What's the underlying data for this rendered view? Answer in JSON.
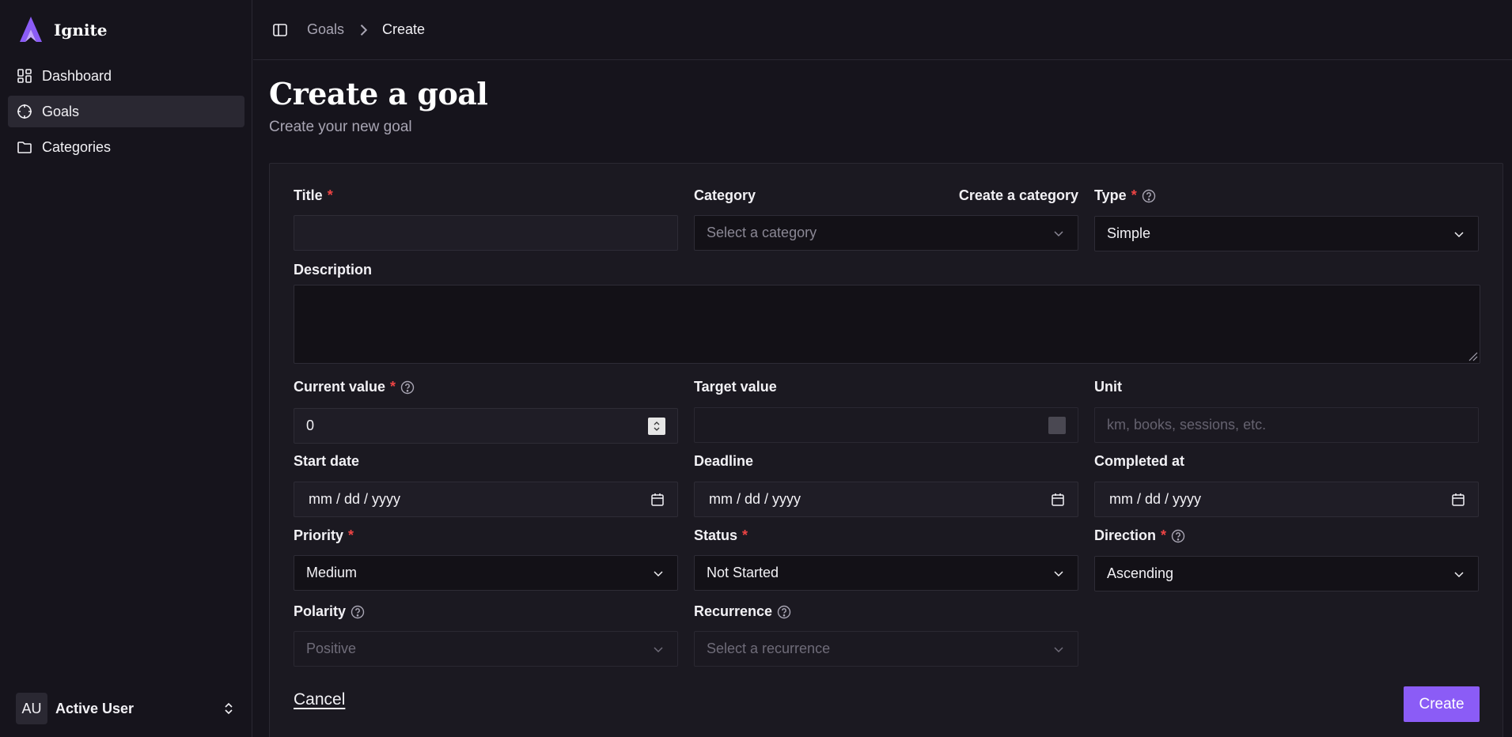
{
  "app": {
    "name": "Ignite"
  },
  "sidebar": {
    "items": [
      {
        "label": "Dashboard",
        "icon": "dashboard-icon",
        "active": false
      },
      {
        "label": "Goals",
        "icon": "target-icon",
        "active": true
      },
      {
        "label": "Categories",
        "icon": "folder-icon",
        "active": false
      }
    ],
    "user": {
      "initials": "AU",
      "name": "Active User"
    }
  },
  "breadcrumb": {
    "parent": "Goals",
    "current": "Create"
  },
  "page": {
    "title": "Create a goal",
    "subtitle": "Create your new goal"
  },
  "form": {
    "title": {
      "label": "Title",
      "value": ""
    },
    "category": {
      "label": "Category",
      "link": "Create a category",
      "placeholder": "Select a category"
    },
    "type": {
      "label": "Type",
      "value": "Simple"
    },
    "description": {
      "label": "Description",
      "value": ""
    },
    "current_value": {
      "label": "Current value",
      "value": "0"
    },
    "target_value": {
      "label": "Target value",
      "value": ""
    },
    "unit": {
      "label": "Unit",
      "placeholder": "km, books, sessions, etc."
    },
    "start_date": {
      "label": "Start date",
      "value": "mm / dd / yyyy"
    },
    "deadline": {
      "label": "Deadline",
      "value": "mm / dd / yyyy"
    },
    "completed_at": {
      "label": "Completed at",
      "value": "mm / dd / yyyy"
    },
    "priority": {
      "label": "Priority",
      "value": "Medium"
    },
    "status": {
      "label": "Status",
      "value": "Not Started"
    },
    "direction": {
      "label": "Direction",
      "value": "Ascending"
    },
    "polarity": {
      "label": "Polarity",
      "value": "Positive"
    },
    "recurrence": {
      "label": "Recurrence",
      "placeholder": "Select a recurrence"
    },
    "required_marker": "*",
    "cancel_label": "Cancel",
    "submit_label": "Create"
  },
  "colors": {
    "accent": "#8b5cf6",
    "background": "#16141c",
    "required": "#ef4444"
  }
}
